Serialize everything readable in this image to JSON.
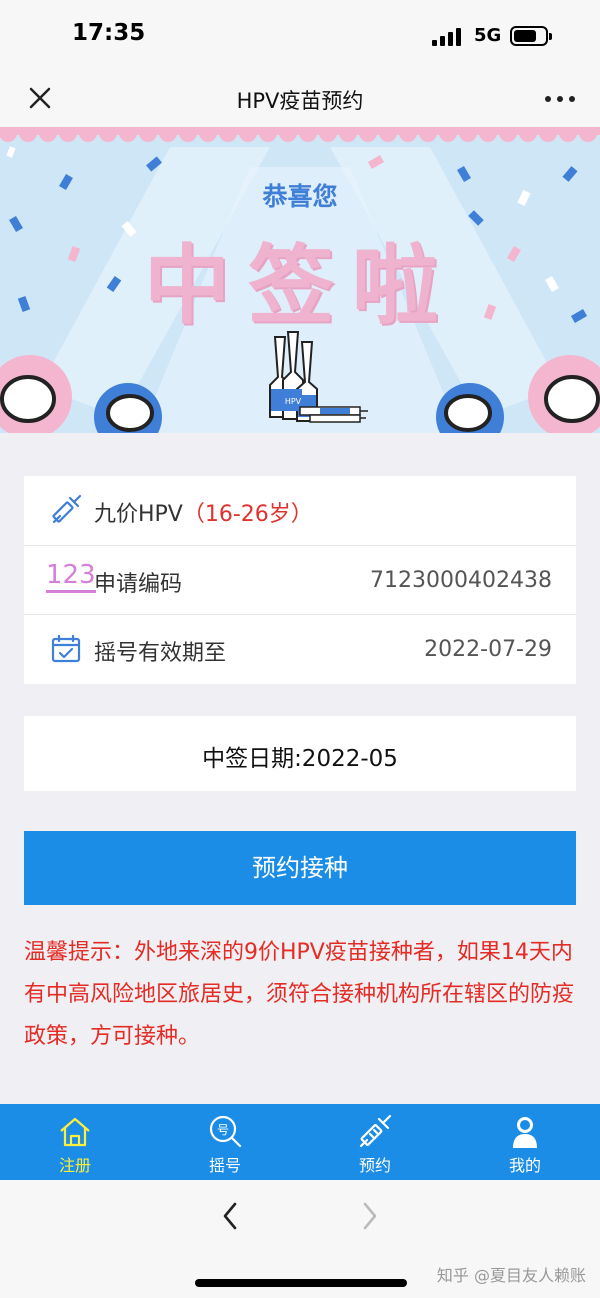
{
  "status_bar": {
    "time": "17:35",
    "network": "5G"
  },
  "nav": {
    "title": "HPV疫苗预约"
  },
  "banner": {
    "congrats": "恭喜您",
    "headline": "中签啦",
    "vial_label": "HPV"
  },
  "info": {
    "vaccine_name": "九价HPV",
    "age_range": "（16-26岁）",
    "code_icon_text": "123",
    "code_label": "申请编码",
    "code_value": "7123000402438",
    "expiry_label": "摇号有效期至",
    "expiry_value": "2022-07-29"
  },
  "win_date": "中签日期:2022-05",
  "book_button": "预约接种",
  "notice": "温馨提示：外地来深的9价HPV疫苗接种者，如果14天内有中高风险地区旅居史，须符合接种机构所在辖区的防疫政策，方可接种。",
  "tabs": [
    {
      "label": "注册",
      "icon": "home-icon",
      "active": true
    },
    {
      "label": "摇号",
      "icon": "lottery-search-icon",
      "active": false
    },
    {
      "label": "预约",
      "icon": "syringe-icon",
      "active": false
    },
    {
      "label": "我的",
      "icon": "user-icon",
      "active": false
    }
  ],
  "watermark": "知乎 @夏目友人赖账",
  "colors": {
    "primary": "#1b8de6",
    "active_tab": "#ffef3b",
    "notice_red": "#e52c24",
    "headline_pink": "#efb3cf"
  }
}
